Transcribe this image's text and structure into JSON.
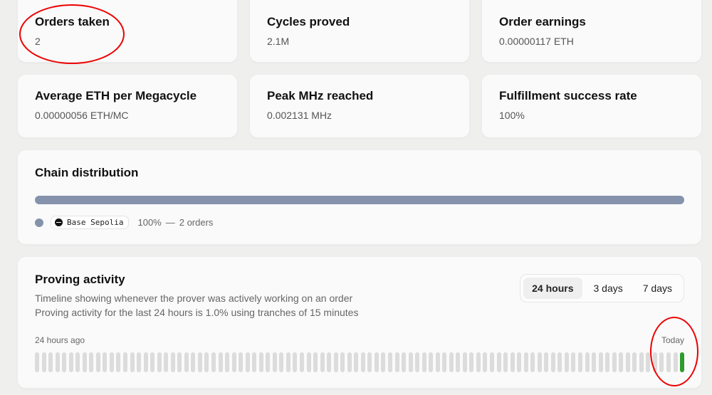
{
  "stats": [
    {
      "title": "Orders taken",
      "value": "2"
    },
    {
      "title": "Cycles proved",
      "value": "2.1M"
    },
    {
      "title": "Order earnings",
      "value": "0.00000117 ETH"
    },
    {
      "title": "Average ETH per Megacycle",
      "value": "0.00000056 ETH/MC"
    },
    {
      "title": "Peak MHz reached",
      "value": "0.002131 MHz"
    },
    {
      "title": "Fulfillment success rate",
      "value": "100%"
    }
  ],
  "chain_distribution": {
    "title": "Chain distribution",
    "bar_color": "#8592ab",
    "legend": [
      {
        "chain": "Base Sepolia",
        "color": "#8592ab",
        "share": "100%",
        "separator": "—",
        "orders": "2 orders"
      }
    ]
  },
  "proving_activity": {
    "title": "Proving activity",
    "description_1": "Timeline showing whenever the prover was actively working on an order",
    "description_2": "Proving activity for the last 24 hours is 1.0% using tranches of 15 minutes",
    "tabs": [
      {
        "label": "24 hours",
        "active": true
      },
      {
        "label": "3 days",
        "active": false
      },
      {
        "label": "7 days",
        "active": false
      }
    ],
    "start_label": "24 hours ago",
    "end_label": "Today",
    "tranche_count": 96,
    "active_tranches": [
      95
    ],
    "active_color": "#2e9b2e",
    "idle_color": "#dcdcdc"
  }
}
